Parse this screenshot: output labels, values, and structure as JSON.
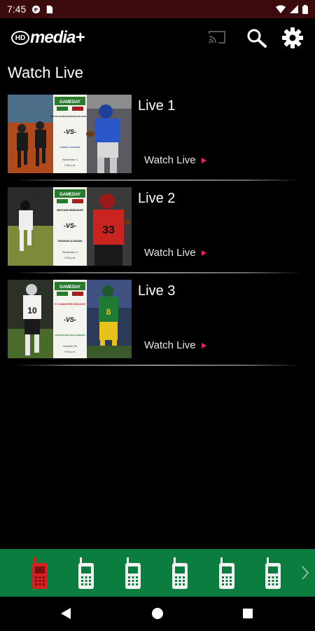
{
  "status_bar": {
    "time": "7:45"
  },
  "app": {
    "logo_badge": "HD",
    "logo_text": "media+"
  },
  "page": {
    "title": "Watch Live"
  },
  "live_items": [
    {
      "title": "Live 1",
      "watch_label": "Watch Live",
      "poster": {
        "brand": "GAMEDAY",
        "team1": "SOUTH CHARLESTON BLACK EAGLES",
        "vs": "-VS-",
        "team2": "CAPITAL COUGARS",
        "date": "November 4",
        "time": "7:00 p.m."
      }
    },
    {
      "title": "Live 2",
      "watch_label": "Watch Live",
      "poster": {
        "brand": "GAMEDAY",
        "team1": "WESTSIDE RENEGADES",
        "vs": "-VS-",
        "team2": "SISSONVILLE INDIANS",
        "date": "November 4",
        "time": "7:00 p.m."
      }
    },
    {
      "title": "Live 3",
      "watch_label": "Watch Live",
      "poster": {
        "brand": "GAMEDAY",
        "team1": "ST. ALBANS RED DRAGONS",
        "vs": "-VS-",
        "team2": "HUNTINGTON HIGHLANDERS",
        "date": "October 28",
        "time": "7:00 p.m."
      }
    }
  ],
  "tab_strip": {
    "active_index": 0,
    "tab_count": 6
  },
  "colors": {
    "status_bar": "#3a0a0d",
    "tab_strip": "#0b7d3e",
    "active_tab": "#d42020",
    "accent": "#e0245e"
  },
  "icons": [
    "cast-icon",
    "search-icon",
    "gear-icon",
    "phone-icon",
    "chevron-right-icon",
    "back-icon",
    "home-icon",
    "recent-apps-icon"
  ]
}
